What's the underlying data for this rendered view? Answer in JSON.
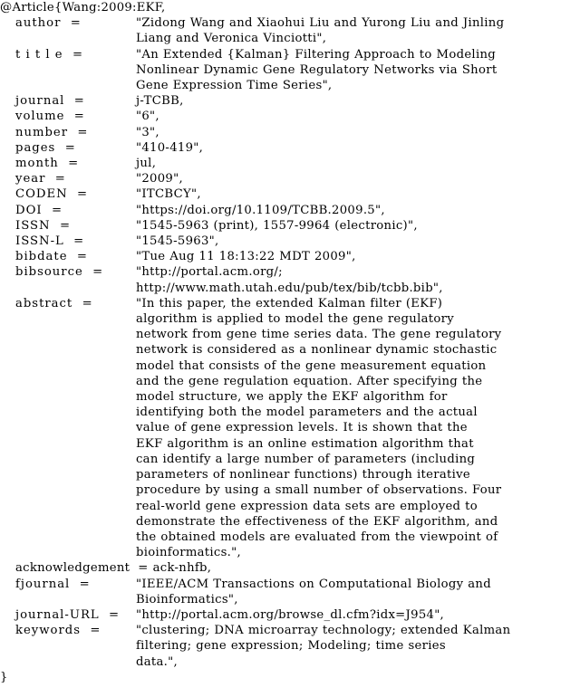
{
  "document": {
    "type": "bibtex-entry",
    "entry_type": "@Article",
    "citation_key": "Wang:2009:EKF",
    "header": "@Article{Wang:2009:EKF,",
    "footer": "}",
    "fields": [
      {
        "name": "author",
        "label": "author  =",
        "value": "\"Zidong Wang and Xiaohui Liu and Yurong Liu and Jinling\nLiang and Veronica Vinciotti\","
      },
      {
        "name": "title",
        "label": "t i t l e  =",
        "value": "\"An Extended {Kalman} Filtering Approach to Modeling\nNonlinear Dynamic Gene Regulatory Networks via Short\nGene Expression Time Series\","
      },
      {
        "name": "journal",
        "label": "journal  =",
        "value": "j-TCBB,"
      },
      {
        "name": "volume",
        "label": "volume  =",
        "value": "\"6\","
      },
      {
        "name": "number",
        "label": "number  =",
        "value": "\"3\","
      },
      {
        "name": "pages",
        "label": "pages  =",
        "value": "\"410-419\","
      },
      {
        "name": "month",
        "label": "month  =",
        "value": "jul,"
      },
      {
        "name": "year",
        "label": "year  =",
        "value": "\"2009\","
      },
      {
        "name": "CODEN",
        "label": "CODEN  =",
        "value": "\"ITCBCY\","
      },
      {
        "name": "DOI",
        "label": "DOI  =",
        "value": "\"https://doi.org/10.1109/TCBB.2009.5\","
      },
      {
        "name": "ISSN",
        "label": "ISSN  =",
        "value": "\"1545-5963 (print), 1557-9964 (electronic)\","
      },
      {
        "name": "ISSN-L",
        "label": "ISSN-L  =",
        "value": "\"1545-5963\","
      },
      {
        "name": "bibdate",
        "label": "bibdate  =",
        "value": "\"Tue Aug 11 18:13:22 MDT 2009\","
      },
      {
        "name": "bibsource",
        "label": "bibsource  =",
        "value": "\"http://portal.acm.org/;\nhttp://www.math.utah.edu/pub/tex/bib/tcbb.bib\","
      },
      {
        "name": "abstract",
        "label": "abstract  =",
        "value": "\"In this paper, the extended Kalman filter (EKF)\nalgorithm is applied to model the gene regulatory\nnetwork from gene time series data. The gene regulatory\nnetwork is considered as a nonlinear dynamic stochastic\nmodel that consists of the gene measurement equation\nand the gene regulation equation. After specifying the\nmodel structure, we apply the EKF algorithm for\nidentifying both the model parameters and the actual\nvalue of gene expression levels. It is shown that the\nEKF algorithm is an online estimation algorithm that\ncan identify a large number of parameters (including\nparameters of nonlinear functions) through iterative\nprocedure by using a small number of observations. Four\nreal-world gene expression data sets are employed to\ndemonstrate the effectiveness of the EKF algorithm, and\nthe obtained models are evaluated from the viewpoint of\nbioinformatics.\","
      },
      {
        "name": "acknowledgement",
        "label": "acknowledgement  =",
        "value": "ack-nhfb,",
        "wide_label": true
      },
      {
        "name": "fjournal",
        "label": "fjournal  =",
        "value": "\"IEEE/ACM Transactions on Computational Biology and\nBioinformatics\","
      },
      {
        "name": "journal-URL",
        "label": "journal-URL  =",
        "value": "\"http://portal.acm.org/browse_dl.cfm?idx=J954\","
      },
      {
        "name": "keywords",
        "label": "keywords  =",
        "value": "\"clustering; DNA microarray technology; extended Kalman\nfiltering; gene expression; Modeling; time series\ndata.\","
      }
    ]
  }
}
